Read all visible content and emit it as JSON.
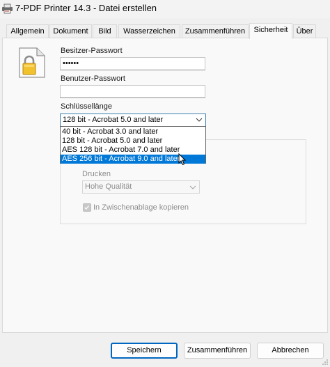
{
  "window": {
    "title": "7-PDF Printer 14.3 - Datei erstellen",
    "app_icon": "printer-icon"
  },
  "tabs": [
    {
      "label": "Allgemein",
      "active": false
    },
    {
      "label": "Dokument",
      "active": false
    },
    {
      "label": "Bild",
      "active": false
    },
    {
      "label": "Wasserzeichen",
      "active": false
    },
    {
      "label": "Zusammenführen",
      "active": false
    },
    {
      "label": "Sicherheit",
      "active": true
    },
    {
      "label": "Über",
      "active": false
    }
  ],
  "security": {
    "icon": "document-lock-icon",
    "owner_password_label": "Besitzer-Passwort",
    "owner_password_value": "••••••",
    "user_password_label": "Benutzer-Passwort",
    "user_password_value": "",
    "key_length_label": "Schlüssellänge",
    "key_length_selected": "128 bit - Acrobat 5.0 and later",
    "key_length_options": [
      "40 bit - Acrobat 3.0 and later",
      "128 bit - Acrobat 5.0 and later",
      "AES 128 bit - Acrobat 7.0 and later",
      "AES 256 bit - Acrobat 9.0 and later"
    ],
    "highlighted_option": "AES 256 bit - Acrobat 9.0 and later"
  },
  "permissions": {
    "print_label": "Drucken",
    "print_quality_value": "Hohe Qualität",
    "copy_clipboard_label": "In Zwischenablage kopieren",
    "copy_clipboard_checked": true,
    "enabled": false
  },
  "buttons": {
    "save": "Speichern",
    "merge": "Zusammenführen",
    "cancel": "Abbrechen"
  },
  "colors": {
    "selection": "#0078d7",
    "primary_border": "#0067c0",
    "combo_focus_border": "#3c7fb1"
  }
}
